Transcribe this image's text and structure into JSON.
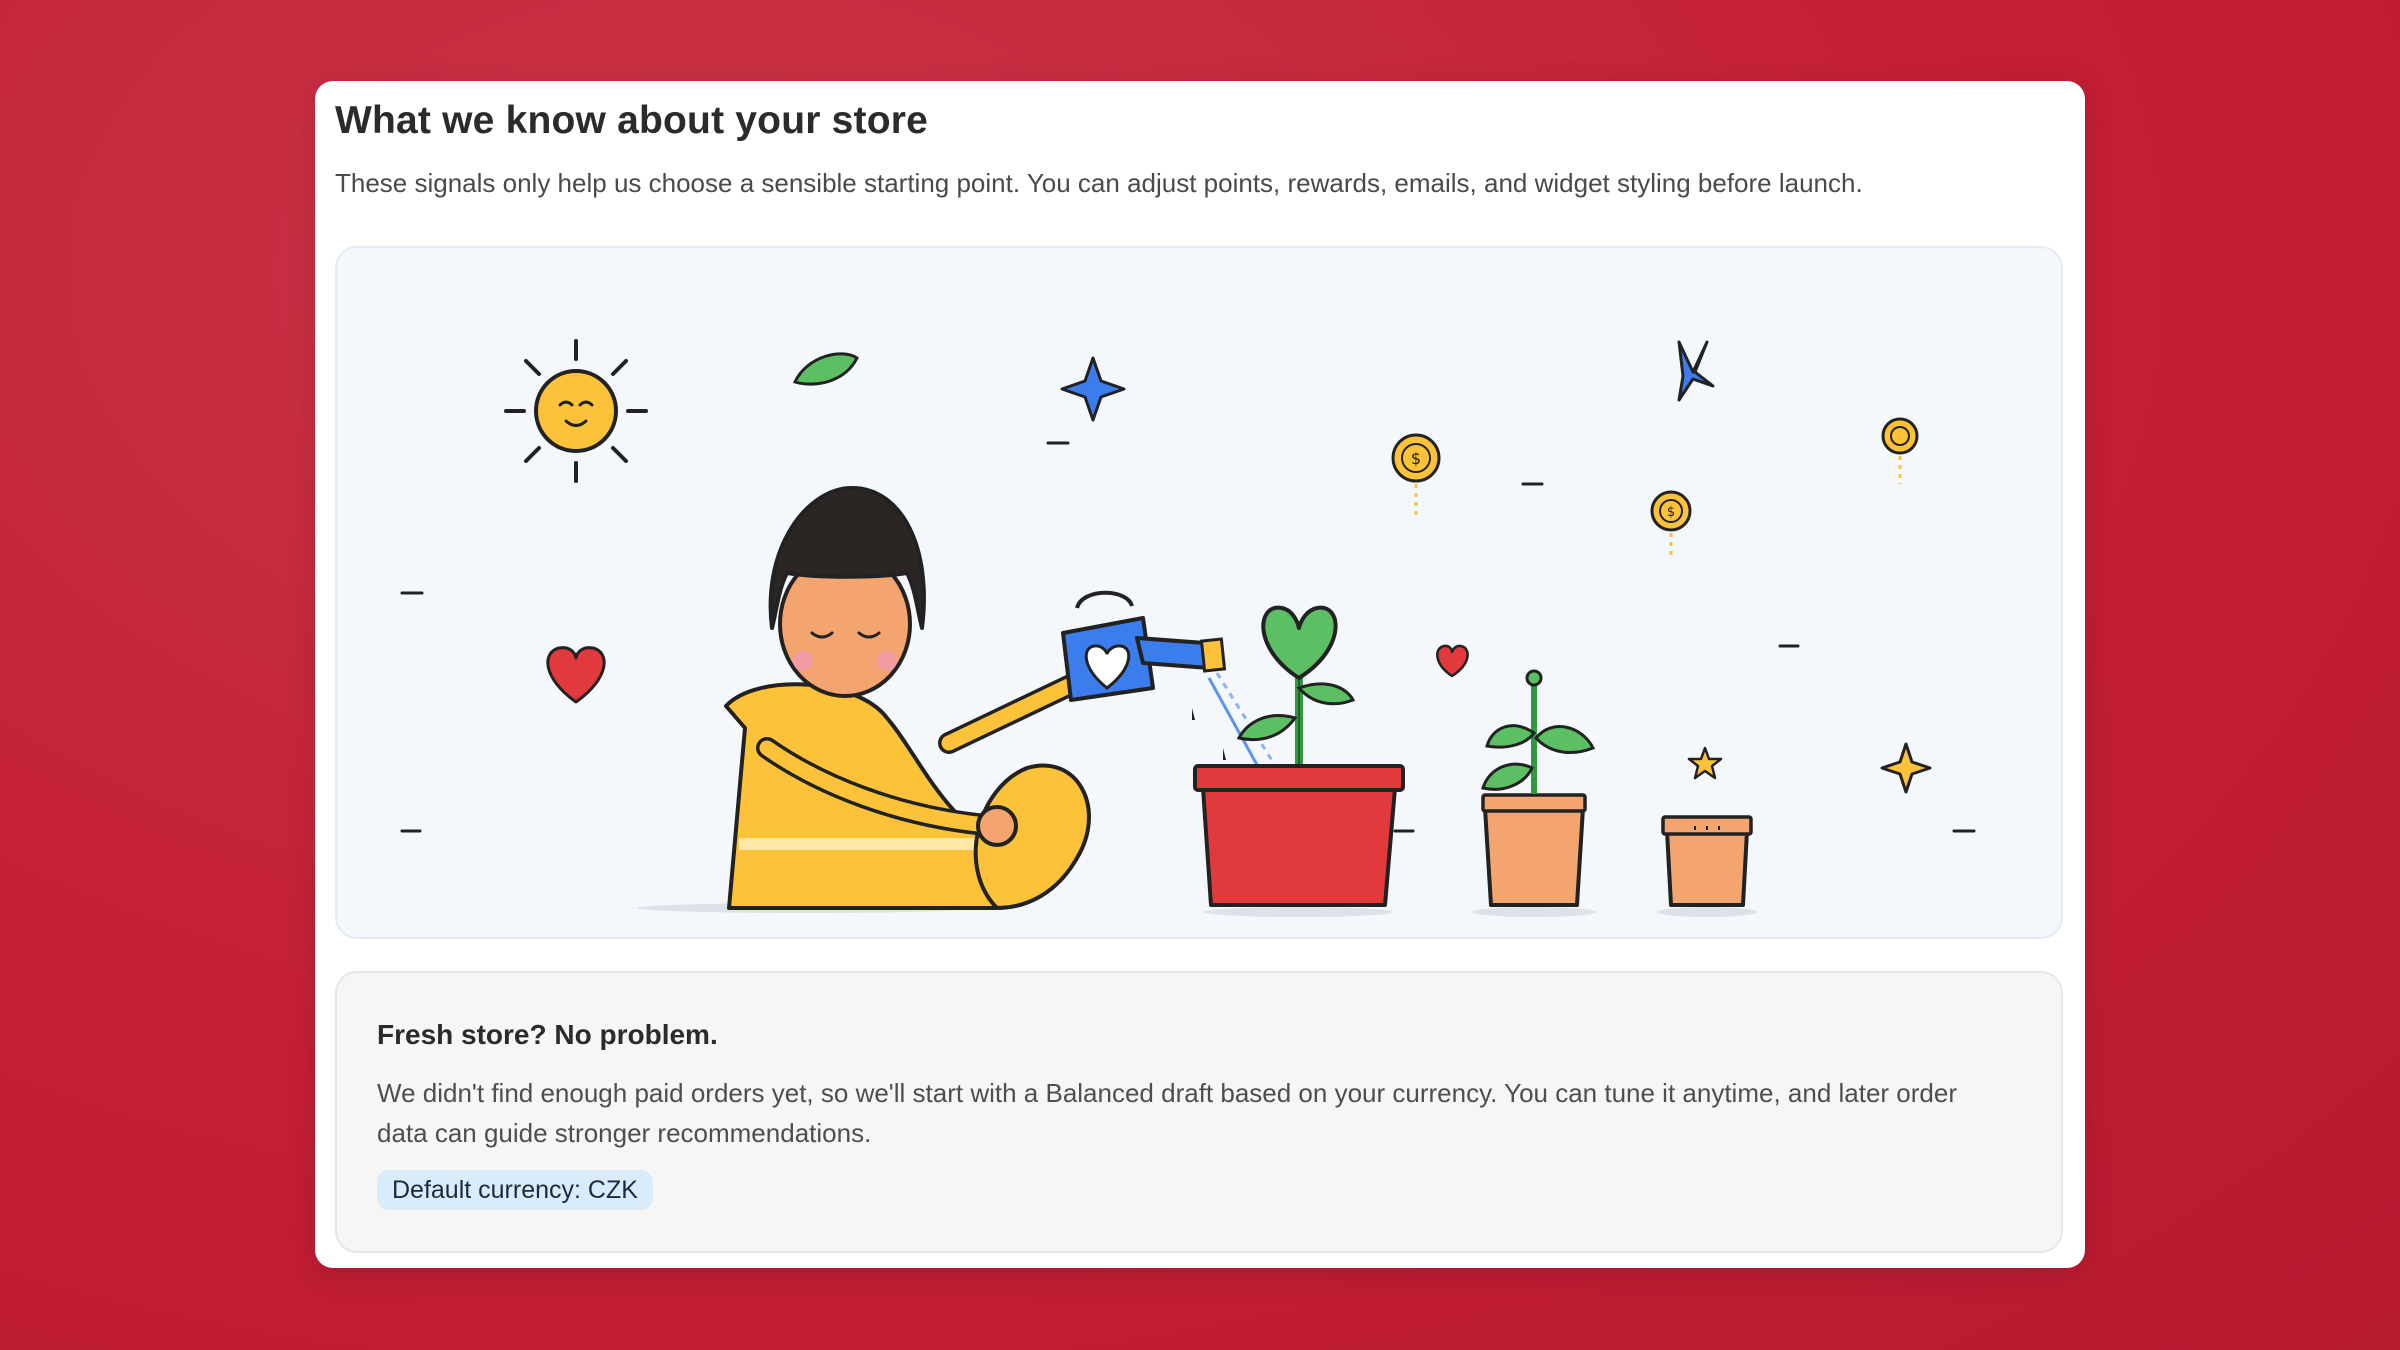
{
  "card": {
    "title": "What we know about your store",
    "subtitle": "These signals only help us choose a sensible starting point. You can adjust points, rewards, emails, and widget styling before launch."
  },
  "illustration": {
    "icons": [
      "sun-icon",
      "leaf-icon",
      "sparkle-icon",
      "coin-icon",
      "heart-icon",
      "star-icon",
      "watering-can-icon",
      "plant-pot-icon"
    ]
  },
  "info": {
    "title": "Fresh store? No problem.",
    "body": "We didn't find enough paid orders yet, so we'll start with a Balanced draft based on your currency. You can tune it anytime, and later order data can guide stronger recommendations.",
    "badge": "Default currency: CZK"
  },
  "colors": {
    "background": "#c41e35",
    "accent_blue": "#3b7ded",
    "accent_yellow": "#fcc33a",
    "accent_red": "#e2393d",
    "badge_bg": "#d8ecfb"
  }
}
